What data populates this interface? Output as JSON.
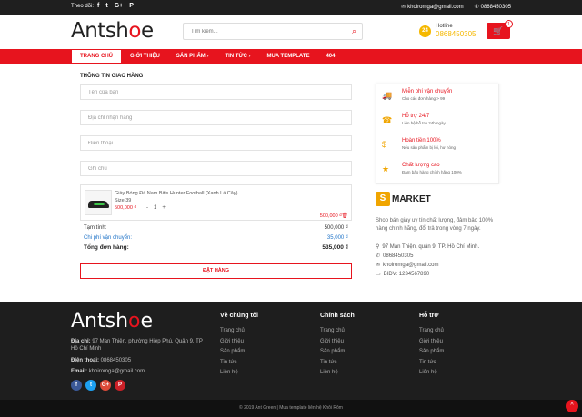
{
  "topbar": {
    "follow": "Theo dõi:",
    "social": [
      "f",
      "t",
      "G+",
      "P"
    ],
    "email": "khoiromga@gmail.com",
    "phone": "0868450305"
  },
  "header": {
    "logo_pre": "Antsh",
    "logo_mid": "o",
    "logo_post": "e",
    "search_placeholder": "Tìm kiếm...",
    "hotline_label": "Hotline",
    "hotline_number": "0868450305",
    "hotline_icon": "24",
    "cart_count": "1"
  },
  "nav": {
    "items": [
      "TRANG CHỦ",
      "GIỚI THIỆU",
      "SẢN PHẨM ›",
      "TIN TỨC ›",
      "MUA TEMPLATE",
      "404"
    ]
  },
  "checkout": {
    "title": "THÔNG TIN GIAO HÀNG",
    "fields": [
      "Tên của bạn",
      "Địa chỉ nhận hàng",
      "Điện thoại",
      "Ghi chú"
    ],
    "product": {
      "name": "Giày Bóng Đá Nam Bitis Hunter Football (Xanh Lá Cây)",
      "size": "Size 39",
      "price": "500,000 ₫",
      "qty_minus": "-",
      "qty": "1",
      "qty_plus": "+",
      "line_total": "500,000 ₫"
    },
    "subtotal_label": "Tạm tính:",
    "subtotal_value": "500,000 ₫",
    "shipping_label": "Chi phí vận chuyển:",
    "shipping_value": "35,000 ₫",
    "total_label": "Tổng đơn hàng:",
    "total_value": "535,000 ₫",
    "order_button": "ĐẶT HÀNG"
  },
  "services": [
    {
      "title": "Miễn phí vận chuyển",
      "desc": "Cho các đơn hàng > 99",
      "icon": "🚚"
    },
    {
      "title": "Hỗ trợ 24/7",
      "desc": "Liên hệ hỗ trợ 24h/ngày",
      "icon": "☎"
    },
    {
      "title": "Hoàn tiền 100%",
      "desc": "Nếu sản phẩm bị lỗi, hư hỏng",
      "icon": "$"
    },
    {
      "title": "Chất lượng cao",
      "desc": "Đảm bảo hàng chính hãng 100%",
      "icon": "★"
    }
  ],
  "store": {
    "badge": "S",
    "name": "MARKET",
    "about": "Shop bán giày uy tín chất lượng, đảm bảo 100% hàng chính hãng, đổi trả trong vòng 7 ngày.",
    "address": "97 Man Thiện, quận 9, TP. Hồ Chí Minh.",
    "phone": "0868450305",
    "email": "khoiromga@gmail.com",
    "bank": "BIDV: 1234567890"
  },
  "footer": {
    "address_label": "Địa chỉ:",
    "address": "97 Man Thiện, phường Hiệp Phú, Quận 9, TP Hồ Chí Minh",
    "phone_label": "Điện thoại:",
    "phone": "0868450305",
    "email_label": "Email:",
    "email": "khoiromga@gmail.com",
    "columns": [
      {
        "title": "Về chúng tôi",
        "links": [
          "Trang chủ",
          "Giới thiệu",
          "Sản phẩm",
          "Tin tức",
          "Liên hệ"
        ]
      },
      {
        "title": "Chính sách",
        "links": [
          "Trang chủ",
          "Giới thiệu",
          "Sản phẩm",
          "Tin tức",
          "Liên hệ"
        ]
      },
      {
        "title": "Hỗ trợ",
        "links": [
          "Trang chủ",
          "Giới thiệu",
          "Sản phẩm",
          "Tin tức",
          "Liên hệ"
        ]
      }
    ],
    "social": [
      {
        "label": "f",
        "color": "#3b5998"
      },
      {
        "label": "t",
        "color": "#1da1f2"
      },
      {
        "label": "G+",
        "color": "#dd4b39"
      },
      {
        "label": "P",
        "color": "#cb2027"
      }
    ],
    "copyright": "© 2019 Ant Green | Mua template liên hệ Khôi Rôm",
    "to_top": "^"
  },
  "colors": {
    "accent": "#e7141e",
    "gold": "#f0a500",
    "dark": "#1e1e1e"
  }
}
